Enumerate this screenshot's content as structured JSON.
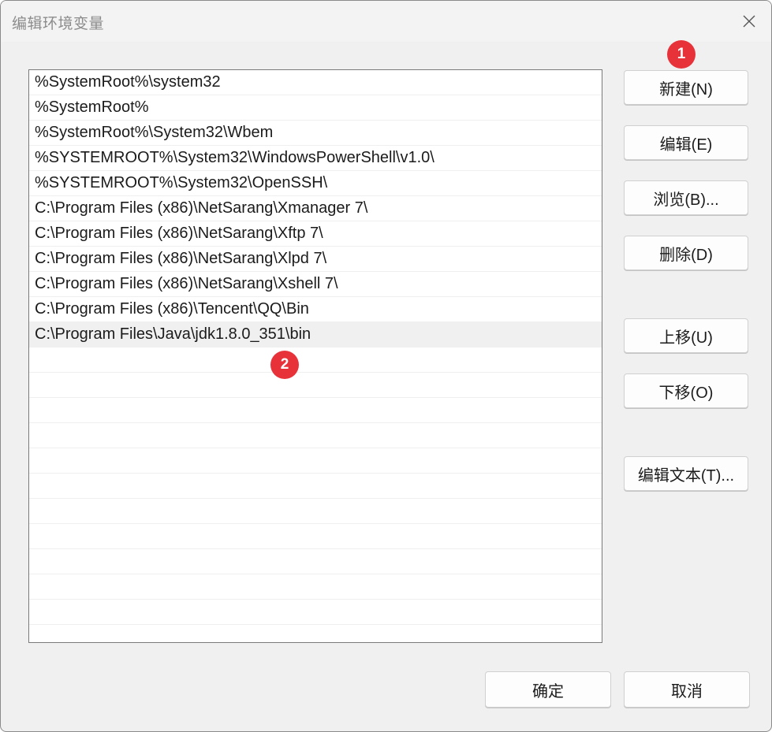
{
  "window": {
    "title": "编辑环境变量"
  },
  "list": {
    "items": [
      "%SystemRoot%\\system32",
      "%SystemRoot%",
      "%SystemRoot%\\System32\\Wbem",
      "%SYSTEMROOT%\\System32\\WindowsPowerShell\\v1.0\\",
      "%SYSTEMROOT%\\System32\\OpenSSH\\",
      "C:\\Program Files (x86)\\NetSarang\\Xmanager 7\\",
      "C:\\Program Files (x86)\\NetSarang\\Xftp 7\\",
      "C:\\Program Files (x86)\\NetSarang\\Xlpd 7\\",
      "C:\\Program Files (x86)\\NetSarang\\Xshell 7\\",
      "C:\\Program Files (x86)\\Tencent\\QQ\\Bin",
      "C:\\Program Files\\Java\\jdk1.8.0_351\\bin"
    ],
    "selected_index": 10
  },
  "buttons": {
    "new": "新建(N)",
    "edit": "编辑(E)",
    "browse": "浏览(B)...",
    "delete": "删除(D)",
    "move_up": "上移(U)",
    "move_down": "下移(O)",
    "edit_text": "编辑文本(T)...",
    "ok": "确定",
    "cancel": "取消"
  },
  "badges": {
    "first": "1",
    "second": "2"
  },
  "colors": {
    "badge": "#e8323a",
    "selection": "#f0f0f0"
  }
}
